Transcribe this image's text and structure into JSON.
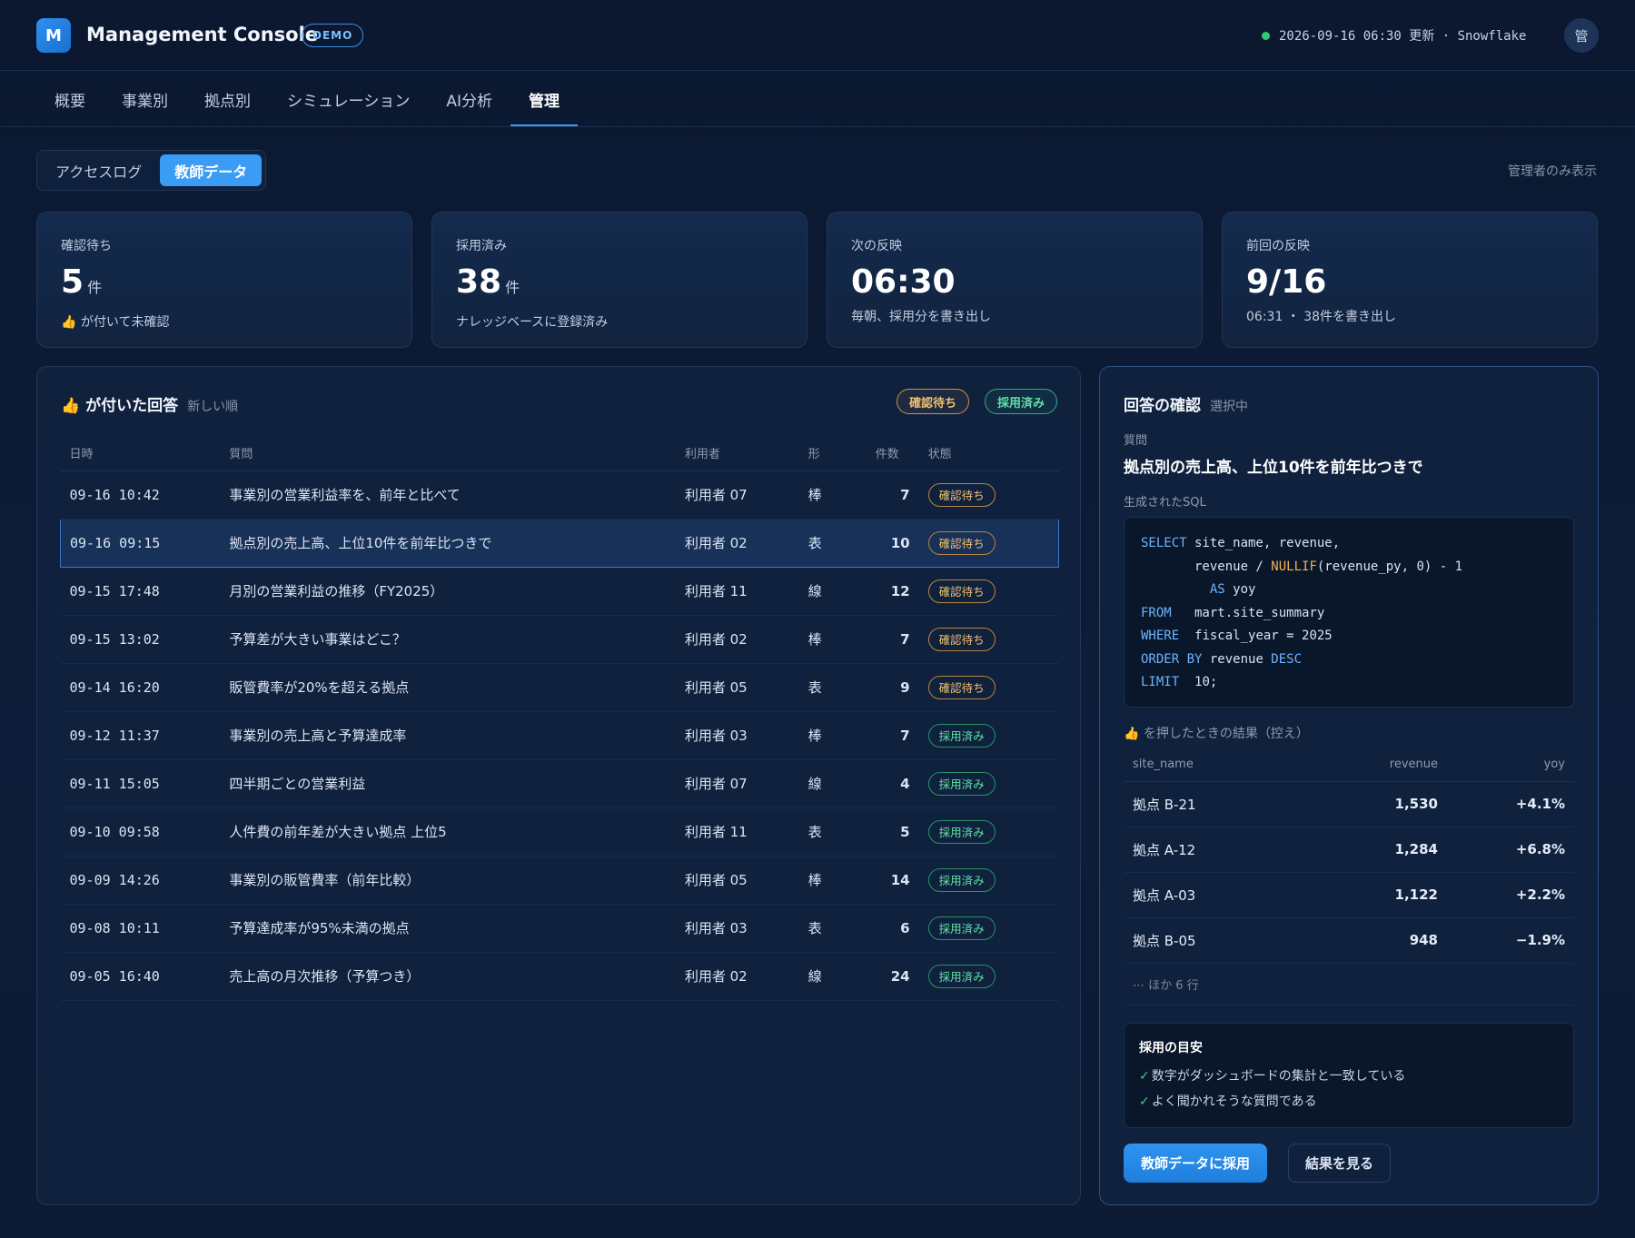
{
  "header": {
    "logo_letter": "M",
    "title": "Management Console",
    "badge": "DEMO",
    "status": "2026-09-16 06:30 更新 · Snowflake",
    "avatar": "管"
  },
  "tabs": [
    "概要",
    "事業別",
    "拠点別",
    "シミュレーション",
    "AI分析",
    "管理"
  ],
  "active_tab": "管理",
  "subtabs": [
    "アクセスログ",
    "教師データ"
  ],
  "admin_note": "管理者のみ表示",
  "stats": [
    {
      "label": "確認待ち",
      "value": "5",
      "unit": "件",
      "sub": "👍 が付いて未確認"
    },
    {
      "label": "採用済み",
      "value": "38",
      "unit": "件",
      "sub": "ナレッジベースに登録済み"
    },
    {
      "label": "次の反映",
      "value": "06:30",
      "unit": "",
      "sub": "毎朝、採用分を書き出し"
    },
    {
      "label": "前回の反映",
      "value": "9/16",
      "unit": "",
      "sub": "06:31 ・ 38件を書き出し"
    }
  ],
  "answers_panel": {
    "title": "👍 が付いた回答",
    "sort": "新しい順",
    "legend_pending": "確認待ち",
    "legend_adopted": "採用済み",
    "columns": {
      "date": "日時",
      "question": "質問",
      "user": "利用者",
      "shape": "形",
      "count": "件数",
      "state": "状態"
    },
    "rows": [
      {
        "date": "09-16 10:42",
        "question": "事業別の営業利益率を、前年と比べて",
        "user": "利用者 07",
        "shape": "棒",
        "count": "7",
        "state": "確認待ち",
        "status": "pending"
      },
      {
        "date": "09-16 09:15",
        "question": "拠点別の売上高、上位10件を前年比つきで",
        "user": "利用者 02",
        "shape": "表",
        "count": "10",
        "state": "確認待ち",
        "status": "pending"
      },
      {
        "date": "09-15 17:48",
        "question": "月別の営業利益の推移（FY2025）",
        "user": "利用者 11",
        "shape": "線",
        "count": "12",
        "state": "確認待ち",
        "status": "pending"
      },
      {
        "date": "09-15 13:02",
        "question": "予算差が大きい事業はどこ？",
        "user": "利用者 02",
        "shape": "棒",
        "count": "7",
        "state": "確認待ち",
        "status": "pending"
      },
      {
        "date": "09-14 16:20",
        "question": "販管費率が20%を超える拠点",
        "user": "利用者 05",
        "shape": "表",
        "count": "9",
        "state": "確認待ち",
        "status": "pending"
      },
      {
        "date": "09-12 11:37",
        "question": "事業別の売上高と予算達成率",
        "user": "利用者 03",
        "shape": "棒",
        "count": "7",
        "state": "採用済み",
        "status": "adopted"
      },
      {
        "date": "09-11 15:05",
        "question": "四半期ごとの営業利益",
        "user": "利用者 07",
        "shape": "線",
        "count": "4",
        "state": "採用済み",
        "status": "adopted"
      },
      {
        "date": "09-10 09:58",
        "question": "人件費の前年差が大きい拠点 上位5",
        "user": "利用者 11",
        "shape": "表",
        "count": "5",
        "state": "採用済み",
        "status": "adopted"
      },
      {
        "date": "09-09 14:26",
        "question": "事業別の販管費率（前年比較）",
        "user": "利用者 05",
        "shape": "棒",
        "count": "14",
        "state": "採用済み",
        "status": "adopted"
      },
      {
        "date": "09-08 10:11",
        "question": "予算達成率が95%未満の拠点",
        "user": "利用者 03",
        "shape": "表",
        "count": "6",
        "state": "採用済み",
        "status": "adopted"
      },
      {
        "date": "09-05 16:40",
        "question": "売上高の月次推移（予算つき）",
        "user": "利用者 02",
        "shape": "線",
        "count": "24",
        "state": "採用済み",
        "status": "adopted"
      }
    ],
    "selected_row": 1
  },
  "review_panel": {
    "title": "回答の確認",
    "sub": "選択中",
    "question_label": "質問",
    "question": "拠点別の売上高、上位10件を前年比つきで",
    "sql_label": "生成されたSQL",
    "sql": {
      "l1_kw": "SELECT",
      "l1_rest": " site_name, revenue,",
      "l2_pre": "       revenue / ",
      "l2_fn": "NULLIF",
      "l2_rest": "(revenue_py, 0) - 1",
      "l3_pre": "         ",
      "l3_kw": "AS",
      "l3_rest": " yoy",
      "l4_kw": "FROM",
      "l4_rest": "   mart.site_summary",
      "l5_kw": "WHERE",
      "l5_rest": "  fiscal_year = 2025",
      "l6_kw1": "ORDER BY",
      "l6_mid": " revenue ",
      "l6_kw2": "DESC",
      "l7_kw": "LIMIT",
      "l7_rest": "  10;"
    },
    "result_label": "👍 を押したときの結果（控え）",
    "result_columns": {
      "site": "site_name",
      "revenue": "revenue",
      "yoy": "yoy"
    },
    "result_rows": [
      {
        "site": "拠点 B-21",
        "revenue": "1,530",
        "yoy": "+4.1%"
      },
      {
        "site": "拠点 A-12",
        "revenue": "1,284",
        "yoy": "+6.8%"
      },
      {
        "site": "拠点 A-03",
        "revenue": "1,122",
        "yoy": "+2.2%"
      },
      {
        "site": "拠点 B-05",
        "revenue": "948",
        "yoy": "−1.9%"
      }
    ],
    "result_more": "⋯ ほか 6 行",
    "criteria_title": "採用の目安",
    "criteria": [
      "数字がダッシュボードの集計と一致している",
      "よく聞かれそうな質問である"
    ],
    "check_mark": "✓",
    "adopt_button": "教師データに採用",
    "view_button": "結果を見る"
  },
  "colors": {
    "accent": "#3a9cf5",
    "pending": "#f0c070",
    "adopted": "#5fe0a6",
    "status_dot": "#2ecc71"
  }
}
